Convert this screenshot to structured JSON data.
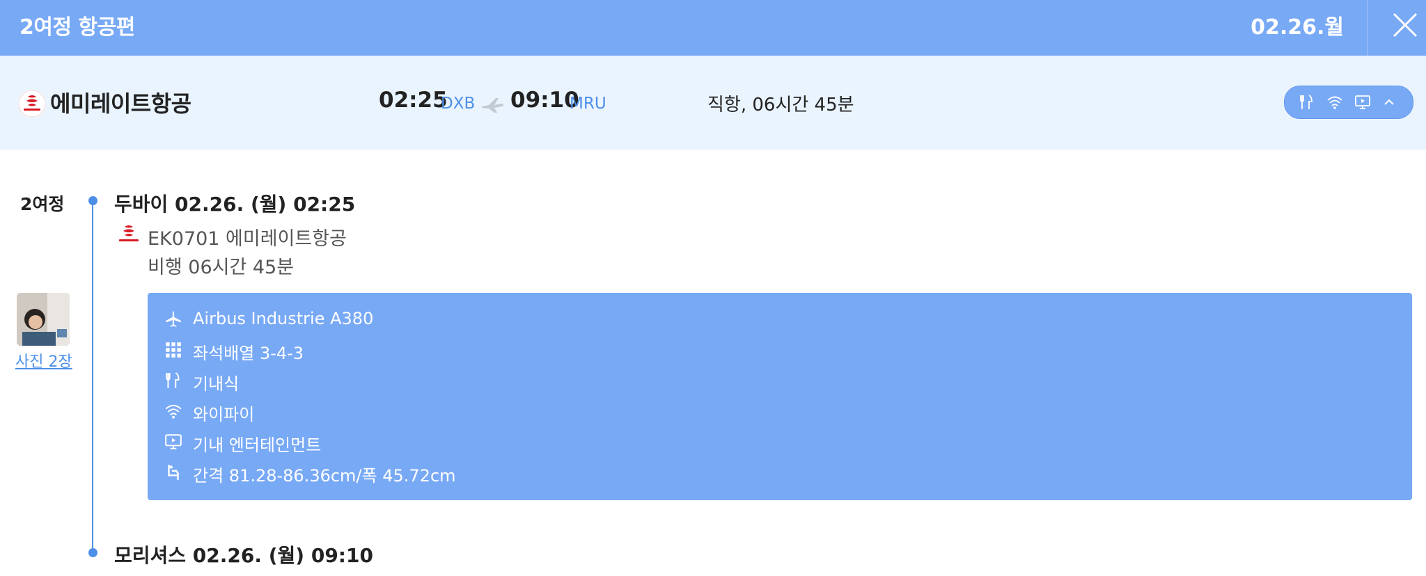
{
  "header": {
    "title": "2여정 항공편",
    "date": "02.26.월"
  },
  "summary": {
    "airline": "에미레이트항공",
    "depart_time": "02:25",
    "depart_code": "DXB",
    "arrive_time": "09:10",
    "arrive_code": "MRU",
    "duration": "직항, 06시간 45분",
    "amenity_icons": [
      "meal-icon",
      "wifi-icon",
      "entertainment-icon",
      "chevron-up-icon"
    ]
  },
  "itinerary": {
    "segment_label": "2여정",
    "departure": "두바이 02.26. (월) 02:25",
    "flight": "EK0701 에미레이트항공",
    "flight_time": "비행 06시간 45분",
    "photo_link": "사진 2장",
    "arrival": "모리셔스 02.26. (월) 09:10",
    "details": [
      {
        "icon": "plane-icon",
        "text": "Airbus Industrie A380"
      },
      {
        "icon": "seat-grid-icon",
        "text": "좌석배열 3-4-3"
      },
      {
        "icon": "meal-icon",
        "text": "기내식"
      },
      {
        "icon": "wifi-icon",
        "text": "와이파이"
      },
      {
        "icon": "entertainment-icon",
        "text": "기내 엔터테인먼트"
      },
      {
        "icon": "seat-pitch-icon",
        "text": "간격 81.28-86.36cm/폭 45.72cm"
      }
    ]
  },
  "colors": {
    "primary": "#78a9f5",
    "accent": "#4d8fe8",
    "summary_bg": "#eaf4fe",
    "brand_red": "#d71921"
  }
}
